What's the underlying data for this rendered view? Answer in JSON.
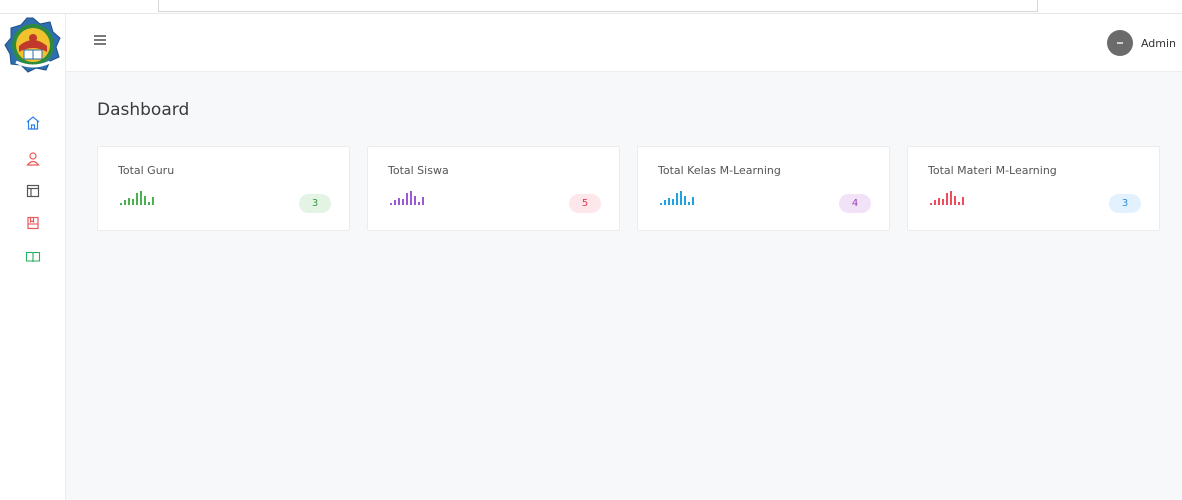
{
  "header": {
    "user_name": "Admin"
  },
  "main": {
    "page_title": "Dashboard"
  },
  "sidebar": {
    "items": [
      {
        "icon": "home-icon",
        "color": "#2f80ed"
      },
      {
        "icon": "user-icon",
        "color": "#eb5757"
      },
      {
        "icon": "layout-icon",
        "color": "#555555"
      },
      {
        "icon": "book-icon",
        "color": "#eb5757"
      },
      {
        "icon": "open-book-icon",
        "color": "#27ae60"
      }
    ]
  },
  "cards": [
    {
      "title": "Total Guru",
      "count": "3",
      "color": "#4caf50",
      "badge_bg": "#e3f4e4",
      "badge_fg": "#3a9a3e"
    },
    {
      "title": "Total Siswa",
      "count": "5",
      "color": "#9b59d6",
      "badge_bg": "#fde7ea",
      "badge_fg": "#e53950"
    },
    {
      "title": "Total Kelas M-Learning",
      "count": "4",
      "color": "#1fa3e0",
      "badge_bg": "#f1e2f7",
      "badge_fg": "#9b3db8"
    },
    {
      "title": "Total Materi M-Learning",
      "count": "3",
      "color": "#ef4c5e",
      "badge_bg": "#e2f1fd",
      "badge_fg": "#2f8fdc"
    }
  ]
}
